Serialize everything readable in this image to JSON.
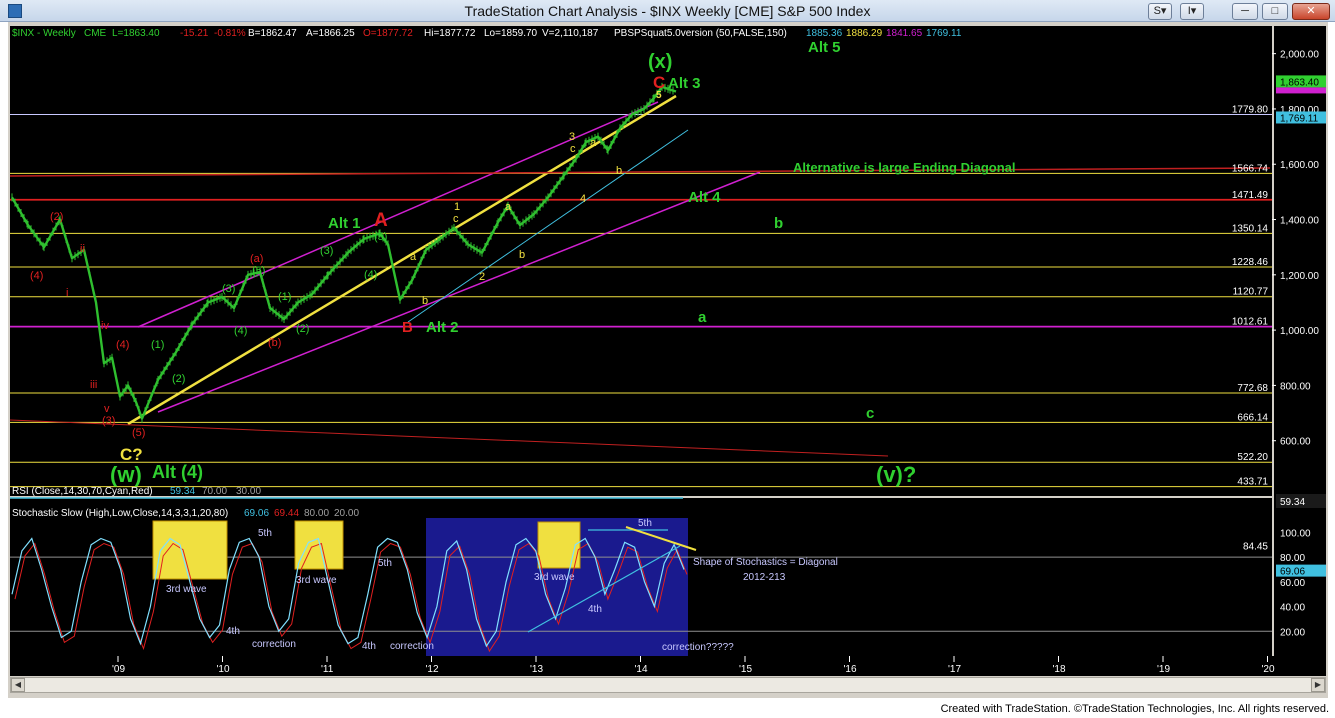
{
  "window": {
    "title": "TradeStation Chart Analysis - $INX Weekly [CME] S&P 500 Index",
    "btn_s": "S",
    "btn_i": "I",
    "footer": "Created with TradeStation. ©TradeStation Technologies, Inc. All rights reserved."
  },
  "colors": {
    "bg": "#000000",
    "price": "#2fbf2f",
    "yellow": "#f0e040",
    "green": "#30d030",
    "red": "#e02020",
    "magenta": "#d020d0",
    "cyan": "#40c0e0",
    "navy": "#1a1a8e"
  },
  "header": {
    "symbol": "$INX - Weekly",
    "exchange": "CME",
    "last": "L=1863.40",
    "change": "-15.21",
    "pct": "-0.81%",
    "bid": "B=1862.47",
    "ask": "A=1866.25",
    "open": "O=1877.72",
    "high": "Hi=1877.72",
    "low": "Lo=1859.70",
    "volume": "V=2,110,187",
    "indicator": "PBSPSquat5.0version (50,FALSE,150)",
    "v1": "1885.36",
    "v2": "1886.29",
    "v3": "1841.65",
    "v4": "1769.11"
  },
  "price_axis": {
    "min": 400,
    "max": 2100,
    "ticks": [
      "2,000.00",
      "1,800.00",
      "1,600.00",
      "1,400.00",
      "1,200.00",
      "1,000.00",
      "800.00",
      "600.00"
    ],
    "tick_values": [
      2000,
      1800,
      1600,
      1400,
      1200,
      1000,
      800,
      600
    ],
    "last_tag": "1,863.40",
    "last_value": 1863.4,
    "tag2": "1,769.11",
    "tag2_value": 1769.11
  },
  "levels": [
    {
      "label": "1779.80",
      "value": 1779.8,
      "color": "#c8c8ff"
    },
    {
      "label": "1566.74",
      "value": 1566.74,
      "color": "#f0e040"
    },
    {
      "label": "1471.49",
      "value": 1471.49,
      "color": "#e02020"
    },
    {
      "label": "1350.14",
      "value": 1350.14,
      "color": "#f0e040"
    },
    {
      "label": "1228.46",
      "value": 1228.46,
      "color": "#f0e040"
    },
    {
      "label": "1120.77",
      "value": 1120.77,
      "color": "#f0e040"
    },
    {
      "label": "1012.61",
      "value": 1012.61,
      "color": "#d020d0"
    },
    {
      "label": "772.68",
      "value": 772.68,
      "color": "#f0e040"
    },
    {
      "label": "666.14",
      "value": 666.14,
      "color": "#f0e040"
    },
    {
      "label": "522.20",
      "value": 522.2,
      "color": "#f0e040"
    },
    {
      "label": "433.71",
      "value": 433.71,
      "color": "#f0e040"
    }
  ],
  "x_axis": [
    "'09",
    "'10",
    "'11",
    "'12",
    "'13",
    "'14",
    "'15",
    "'16",
    "'17",
    "'18",
    "'19",
    "'20"
  ],
  "rsi": {
    "label": "RSI (Close,14,30,70,Cyan,Red)",
    "value": "59.34",
    "upper": "70.00",
    "lower": "30.00",
    "tag": "59.34"
  },
  "stoch": {
    "label": "Stochastic Slow (High,Low,Close,14,3,3,1,20,80)",
    "k": "69.06",
    "d": "69.44",
    "upper": "80.00",
    "lower": "20.00",
    "ticks": [
      "100.00",
      "80.00",
      "60.00",
      "40.00",
      "20.00"
    ],
    "tick_values": [
      100,
      80,
      60,
      40,
      20
    ],
    "tag1": "84.45",
    "tag1_value": 84.45,
    "tag2": "69.06",
    "tag2_value": 69.06
  },
  "annotations": {
    "x_wave": "(x)",
    "c_red": "C",
    "alt3": "Alt 3",
    "alt5": "Alt 5",
    "five_top": "5",
    "ending_diag": "Alternative is large Ending Diagonal",
    "alt4": "Alt 4",
    "b_green": "b",
    "a_green": "a",
    "c_green": "c",
    "v_wave": "(v)?",
    "alt1": "Alt 1",
    "a_red_big": "A",
    "b_red": "B",
    "alt2": "Alt 2",
    "c_q": "C?",
    "w_wave": "(w)",
    "alt_4_paren": "Alt (4)",
    "two_red": "(2)",
    "four_red": "(4)",
    "four_red2": "(4)",
    "three_red": "(3)",
    "five_red": "(5)",
    "ii": "ii",
    "i": "i",
    "iv": "iv",
    "iii": "iii",
    "v": "v",
    "a_red": "(a)",
    "b_red_paren": "(b)",
    "g1": "(1)",
    "g2": "(2)",
    "g3": "(3)",
    "g4": "(4)",
    "g5": "(5)",
    "g1b": "(1)",
    "g2b": "(2)",
    "g3b": "(3)",
    "g4b": "(4)",
    "g5b": "(5)",
    "y1": "1",
    "yc": "c",
    "ya": "a",
    "yb": "b",
    "y2": "2",
    "ya2": "a",
    "yb2": "b",
    "y3": "3",
    "yc2": "c",
    "ya3": "a",
    "yb3": "b",
    "y4": "4"
  },
  "stoch_notes": {
    "third1": "3rd wave",
    "fifth1": "5th",
    "fourth1": "4th",
    "corr1": "correction",
    "third2": "3rd wave",
    "fifth2": "5th",
    "fourth2": "4th",
    "corr2": "correction",
    "third3": "3rd wave",
    "fifth3": "5th",
    "fourth3": "4th",
    "corr3": "correction?????",
    "shape": "Shape of Stochastics = Diagonal",
    "years": "2012-213"
  }
}
